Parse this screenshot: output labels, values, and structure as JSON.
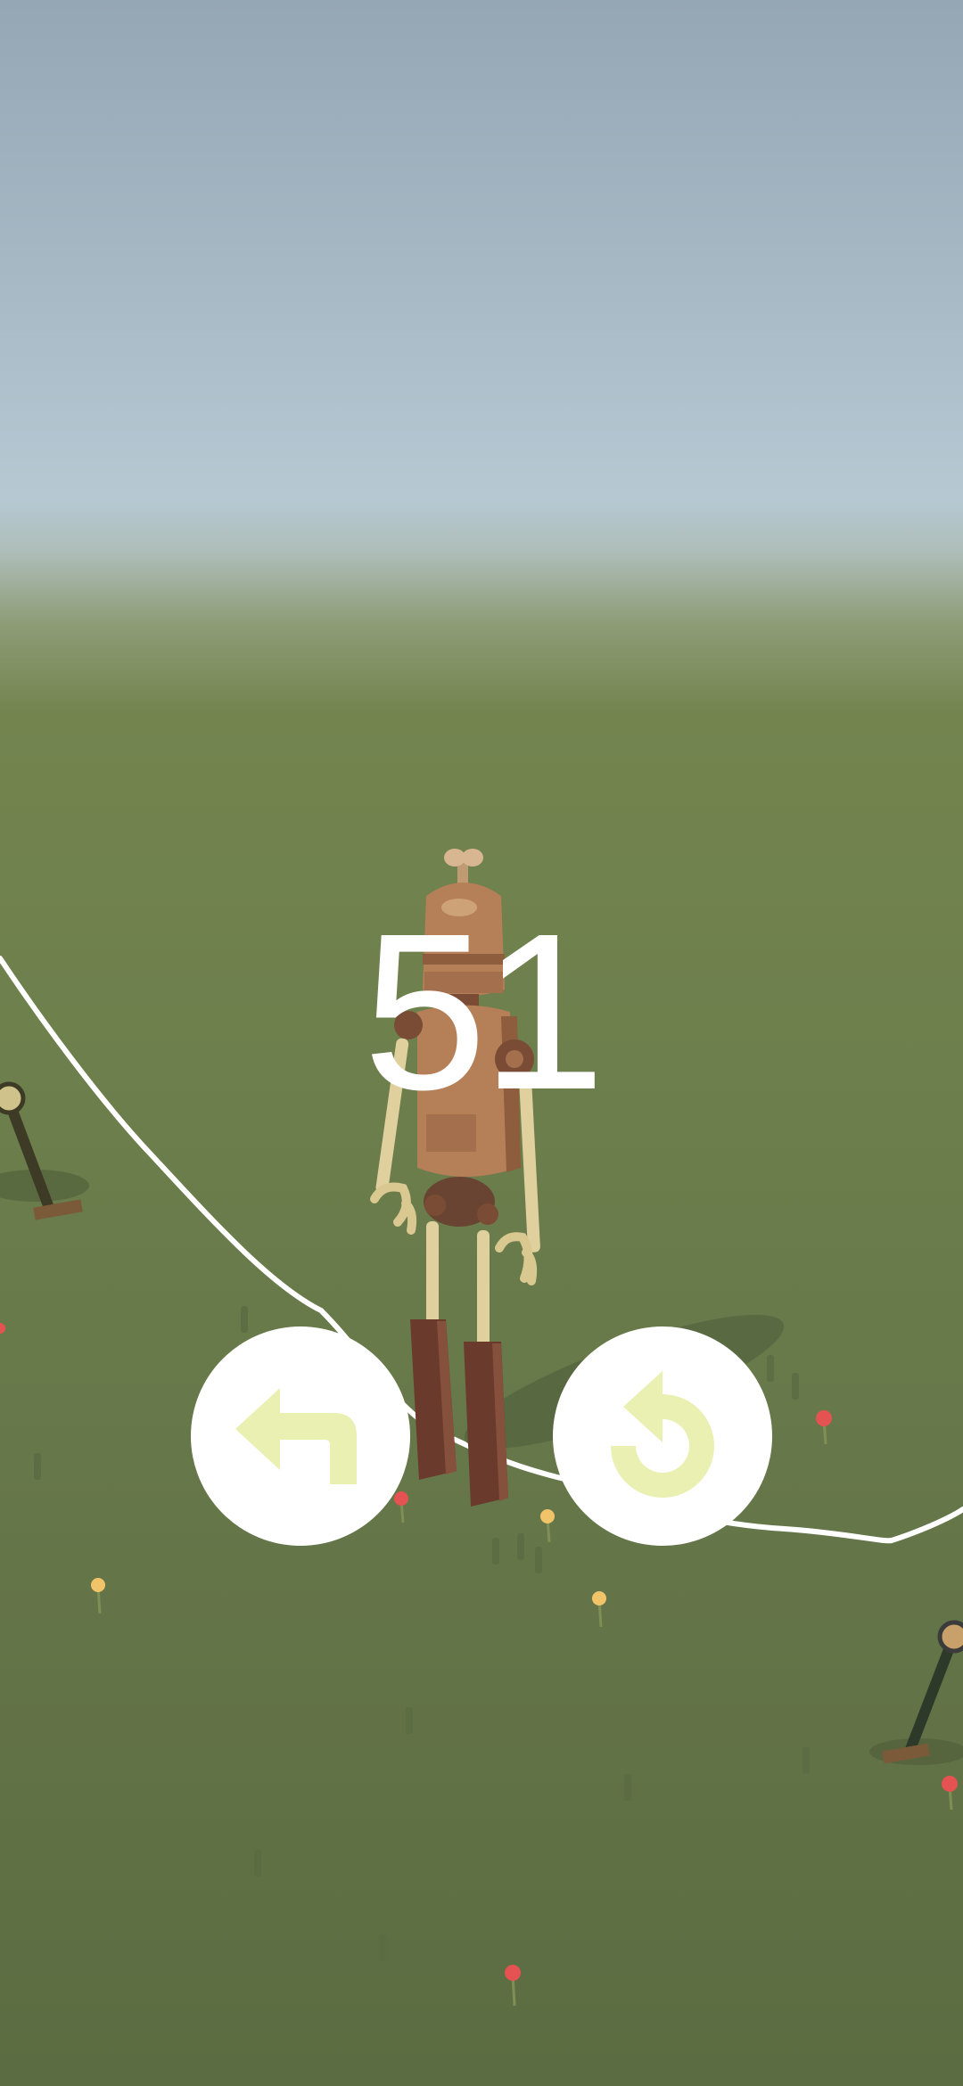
{
  "game": {
    "score": "51"
  },
  "controls": {
    "back_icon": "turn-back-arrow-icon",
    "restart_icon": "restart-arrow-icon",
    "icon_color": "#eaefb2"
  },
  "colors": {
    "sky_top": "#95a6b5",
    "sky_horizon": "#b6c9d3",
    "grass": "#6b7c4c",
    "path_line": "#ffffff",
    "button_bg": "#ffffff"
  }
}
